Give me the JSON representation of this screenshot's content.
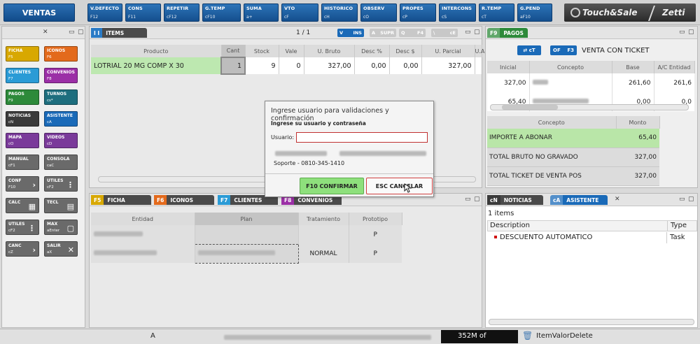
{
  "app": {
    "module_label": "VENTAS"
  },
  "toolbar": [
    {
      "label": "V.DEFECTO",
      "key": "F12"
    },
    {
      "label": "CONS",
      "key": "F11"
    },
    {
      "label": "REPETIR",
      "key": "cF12"
    },
    {
      "label": "G.TEMP",
      "key": "cF10"
    },
    {
      "label": "SUMA",
      "key": "a+"
    },
    {
      "label": "VTO",
      "key": "cF"
    },
    {
      "label": "HISTORICO",
      "key": "cH"
    },
    {
      "label": "OBSERV",
      "key": "cO"
    },
    {
      "label": "PROPES",
      "key": "cP"
    },
    {
      "label": "INTERCONS",
      "key": "cS"
    },
    {
      "label": "R.TEMP",
      "key": "cT"
    },
    {
      "label": "G.PEND",
      "key": "aF10"
    }
  ],
  "logo": {
    "brand": "Touch&Sale",
    "company": "Zetti"
  },
  "left_grid": [
    {
      "label": "FICHA",
      "key": "F5",
      "color": "#d8a800"
    },
    {
      "label": "ICONOS",
      "key": "F6",
      "color": "#e36a1c"
    },
    {
      "label": "CLIENTES",
      "key": "F7",
      "color": "#2a9bd6"
    },
    {
      "label": "CONVENIOS",
      "key": "F8",
      "color": "#9b2fa6"
    },
    {
      "label": "PAGOS",
      "key": "F9",
      "color": "#2d8a3a"
    },
    {
      "label": "TURNOS",
      "key": "cs*",
      "color": "#1e6e7e"
    },
    {
      "label": "NOTICIAS",
      "key": "cN",
      "color": "#3a3a3a"
    },
    {
      "label": "ASISTENTE",
      "key": "cA",
      "color": "#1a6ab8"
    },
    {
      "label": "MAPA",
      "key": "cO",
      "color": "#7a3a9a"
    },
    {
      "label": "VIDEOS",
      "key": "cD",
      "color": "#7a3a9a"
    },
    {
      "label": "MANUAL",
      "key": "cF1",
      "color": "#6a6a6a"
    },
    {
      "label": "CONSOLA",
      "key": "caC",
      "color": "#6a6a6a"
    },
    {
      "label": "CONF",
      "key": "F10",
      "color": "#6a6a6a",
      "glyph": "›"
    },
    {
      "label": "UTILES",
      "key": "cF2",
      "color": "#6a6a6a",
      "glyph": "⋮"
    },
    {
      "label": "CALC",
      "key": "",
      "color": "#6a6a6a",
      "glyph": "▦"
    },
    {
      "label": "TECL",
      "key": "",
      "color": "#6a6a6a",
      "glyph": "▤"
    },
    {
      "label": "UTILES",
      "key": "cF2",
      "color": "#6a6a6a",
      "glyph": "⋮"
    },
    {
      "label": "MAX",
      "key": "aEnter",
      "color": "#6a6a6a",
      "glyph": "▢"
    },
    {
      "label": "CANC",
      "key": "cZ",
      "color": "#6a6a6a",
      "glyph": "›"
    },
    {
      "label": "SALIR",
      "key": "aX",
      "color": "#6a6a6a",
      "glyph": "✕"
    }
  ],
  "items_panel": {
    "tab_key": "I I",
    "tab_label": "ITEMS",
    "page": "1 / 1",
    "mode_buttons": [
      {
        "key": "V",
        "label": "INS"
      },
      {
        "key": "A",
        "label": "SUPR"
      },
      {
        "key": "Q",
        "label": "F4"
      },
      {
        "key": "\\",
        "label": "cE"
      }
    ],
    "columns": [
      "Producto",
      "Cant",
      "Stock",
      "Vale",
      "U. Bruto",
      "Desc %",
      "Desc $",
      "U. Parcial",
      "U.A"
    ],
    "rows": [
      {
        "producto": "LOTRIAL  20   MG COMP X 30",
        "cant": "1",
        "stock": "9",
        "vale": "0",
        "u_bruto": "327,00",
        "desc_pct": "0,00",
        "desc_amt": "0,00",
        "u_parcial": "327,00"
      }
    ]
  },
  "pagos_panel": {
    "tab_key": "F9",
    "tab_label": "PAGOS",
    "ticket_buttons": [
      {
        "key": "cT",
        "label": "cT"
      },
      {
        "key": "OF",
        "label": "F3"
      }
    ],
    "ticket_title": "VENTA CON TICKET",
    "pay_columns": [
      "Inicial",
      "Concepto",
      "Base",
      "A/C Entidad"
    ],
    "pay_rows": [
      {
        "inicial": "327,00",
        "base": "261,60",
        "ac": "261,6"
      },
      {
        "inicial": "65,40",
        "base": "0,00",
        "ac": "0,0"
      }
    ],
    "totals_columns": [
      "Concepto",
      "Monto"
    ],
    "totals": [
      {
        "concepto": "IMPORTE A ABONAR",
        "monto": "65,40"
      },
      {
        "concepto": "TOTAL BRUTO NO GRAVADO",
        "monto": "327,00"
      },
      {
        "concepto": "TOTAL TICKET DE VENTA POS",
        "monto": "327,00"
      }
    ]
  },
  "bottom_tabs": [
    {
      "key": "F5",
      "label": "FICHA",
      "color": "#d8a800"
    },
    {
      "key": "F6",
      "label": "ICONOS",
      "color": "#e36a1c"
    },
    {
      "key": "F7",
      "label": "CLIENTES",
      "color": "#2a9bd6"
    },
    {
      "key": "F8",
      "label": "CONVENIOS",
      "color": "#9b2fa6"
    }
  ],
  "convenios": {
    "columns": [
      "Entidad",
      "Plan",
      "Tratamiento",
      "Prototipo"
    ],
    "rows": [
      {
        "tratamiento": "",
        "prototipo": "P"
      },
      {
        "tratamiento": "NORMAL",
        "prototipo": "P"
      }
    ]
  },
  "asistente_panel": {
    "tabs": [
      {
        "key": "cN",
        "label": "NOTICIAS"
      },
      {
        "key": "cA",
        "label": "ASISTENTE"
      }
    ],
    "count": "1 items",
    "columns": [
      "Description",
      "Type"
    ],
    "rows": [
      {
        "description": "DESCUENTO AUTOMATICO",
        "type": "Task"
      }
    ]
  },
  "dialog": {
    "title": "Ingrese usuario para validaciones y confirmación",
    "subtitle": "Ingrese su usuario y contraseña",
    "user_label": "Usuario:",
    "user_value": "",
    "support": "Soporte -  0810-345-1410",
    "confirm_label": "F10  CONFIRMAR",
    "cancel_label": "ESC  CANCELAR"
  },
  "status": {
    "left": "A",
    "memory": "352M of",
    "action": "ItemValorDelete"
  }
}
